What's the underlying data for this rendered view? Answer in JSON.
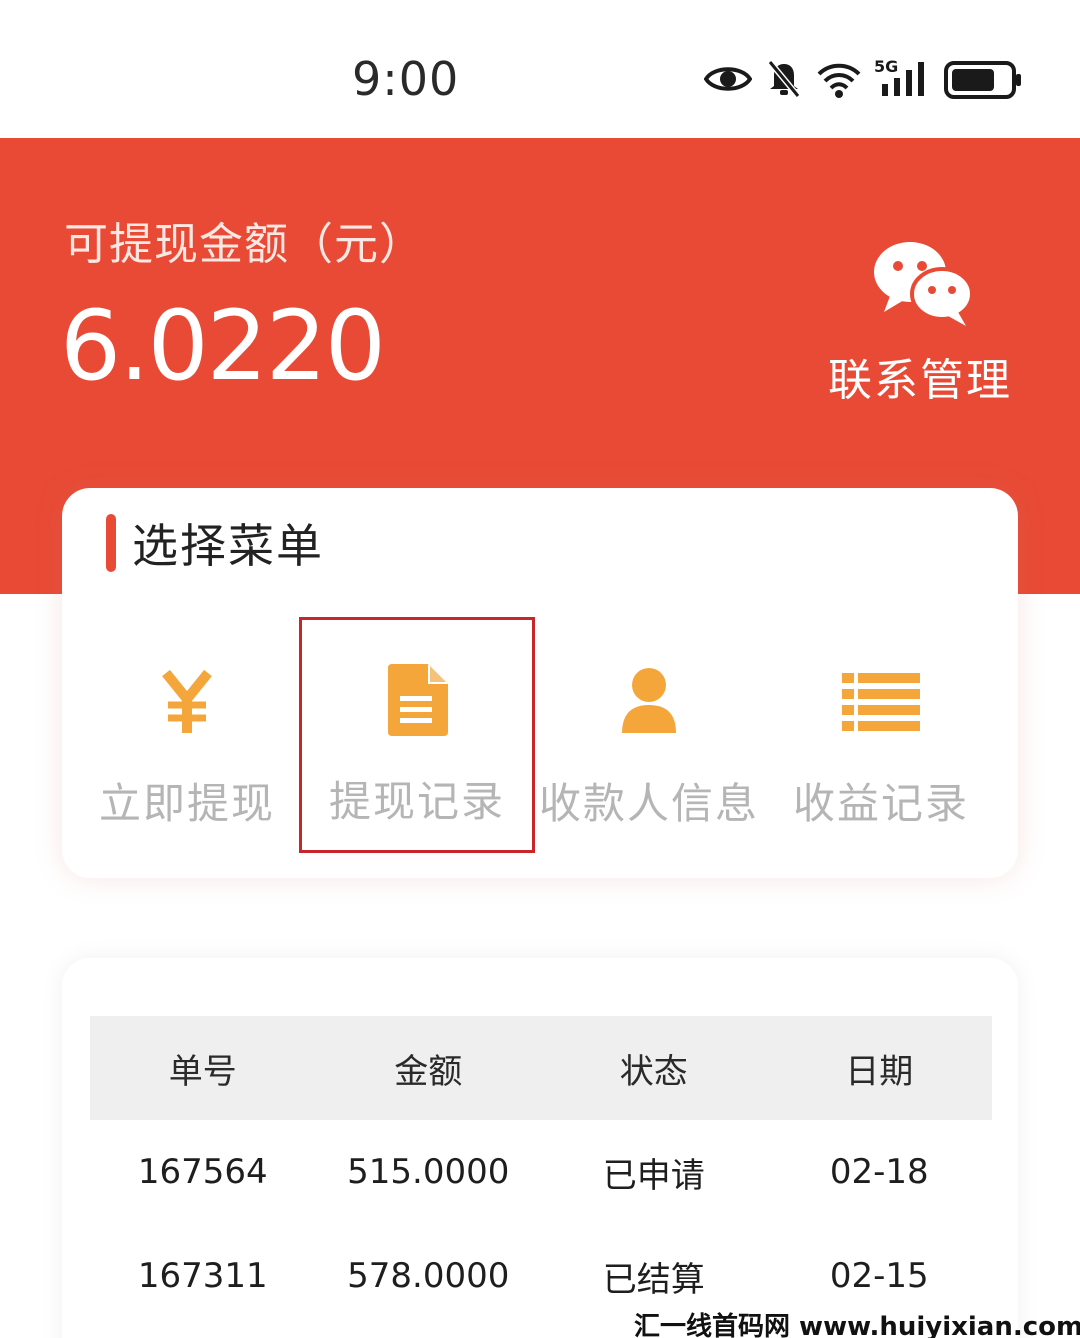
{
  "status_bar": {
    "time": "9:00",
    "icons": [
      "eye-icon",
      "bell-muted-icon",
      "wifi-icon",
      "5g-signal-icon",
      "battery-icon"
    ],
    "network_label": "5G"
  },
  "header": {
    "balance_label": "可提现金额（元）",
    "balance_value": "6.0220",
    "contact_label": "联系管理",
    "contact_icon": "wechat-icon",
    "background_color": "#e84a35"
  },
  "menu": {
    "title": "选择菜单",
    "items": [
      {
        "label": "立即提现",
        "icon": "yuan-icon"
      },
      {
        "label": "提现记录",
        "icon": "document-icon",
        "selected": true
      },
      {
        "label": "收款人信息",
        "icon": "person-icon"
      },
      {
        "label": "收益记录",
        "icon": "list-icon"
      }
    ],
    "icon_color": "#f5a63b"
  },
  "table": {
    "headers": [
      "单号",
      "金额",
      "状态",
      "日期"
    ],
    "rows": [
      [
        "167564",
        "515.0000",
        "已申请",
        "02-18"
      ],
      [
        "167311",
        "578.0000",
        "已结算",
        "02-15"
      ]
    ]
  },
  "watermark": "汇一线首码网 www.huiyixian.com"
}
